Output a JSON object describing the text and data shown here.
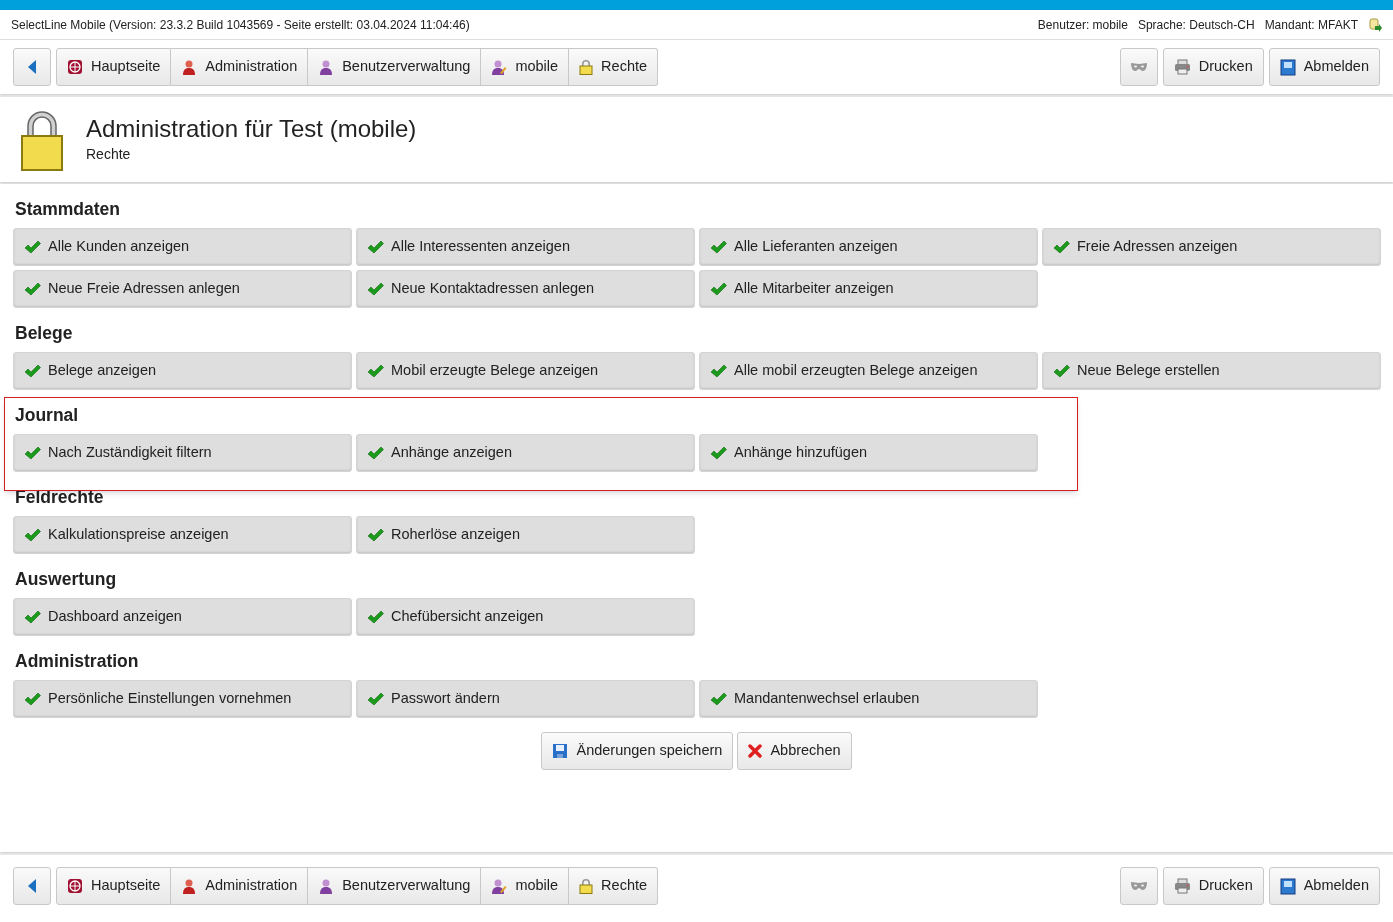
{
  "info_bar": {
    "version": "SelectLine Mobile (Version: 23.3.2 Build 1043569 - Seite erstellt: 03.04.2024 11:04:46)",
    "user": "Benutzer: mobile",
    "language": "Sprache: Deutsch-CH",
    "client": "Mandant: MFAKT"
  },
  "top_nav": {
    "breadcrumbs": [
      {
        "kind": "home",
        "label": "Hauptseite"
      },
      {
        "kind": "admin",
        "label": "Administration"
      },
      {
        "kind": "users",
        "label": "Benutzerverwaltung"
      },
      {
        "kind": "user",
        "label": "mobile"
      },
      {
        "kind": "lock",
        "label": "Rechte"
      }
    ],
    "actions": [
      {
        "kind": "mask"
      },
      {
        "kind": "print",
        "label": "Drucken"
      },
      {
        "kind": "logout",
        "label": "Abmelden"
      }
    ]
  },
  "page_header": {
    "title": "Administration für Test (mobile)",
    "subtitle": "Rechte"
  },
  "sections": [
    {
      "title": "Stammdaten",
      "highlighted": false,
      "permissions": [
        {
          "label": "Alle Kunden anzeigen",
          "checked": true
        },
        {
          "label": "Alle Interessenten anzeigen",
          "checked": true
        },
        {
          "label": "Alle Lieferanten anzeigen",
          "checked": true
        },
        {
          "label": "Freie Adressen anzeigen",
          "checked": true
        },
        {
          "label": "Neue Freie Adressen anlegen",
          "checked": true
        },
        {
          "label": "Neue Kontaktadressen anlegen",
          "checked": true
        },
        {
          "label": "Alle Mitarbeiter anzeigen",
          "checked": true
        }
      ]
    },
    {
      "title": "Belege",
      "highlighted": false,
      "permissions": [
        {
          "label": "Belege anzeigen",
          "checked": true
        },
        {
          "label": "Mobil erzeugte Belege anzeigen",
          "checked": true
        },
        {
          "label": "Alle mobil erzeugten Belege anzeigen",
          "checked": true
        },
        {
          "label": "Neue Belege erstellen",
          "checked": true
        }
      ]
    },
    {
      "title": "Journal",
      "highlighted": true,
      "permissions": [
        {
          "label": "Nach Zuständigkeit filtern",
          "checked": true
        },
        {
          "label": "Anhänge anzeigen",
          "checked": true
        },
        {
          "label": "Anhänge hinzufügen",
          "checked": true
        }
      ]
    },
    {
      "title": "Feldrechte",
      "highlighted": false,
      "permissions": [
        {
          "label": "Kalkulationspreise anzeigen",
          "checked": true
        },
        {
          "label": "Roherlöse anzeigen",
          "checked": true
        }
      ]
    },
    {
      "title": "Auswertung",
      "highlighted": false,
      "permissions": [
        {
          "label": "Dashboard anzeigen",
          "checked": true
        },
        {
          "label": "Chefübersicht anzeigen",
          "checked": true
        }
      ]
    },
    {
      "title": "Administration",
      "highlighted": false,
      "permissions": [
        {
          "label": "Persönliche Einstellungen vornehmen",
          "checked": true
        },
        {
          "label": "Passwort ändern",
          "checked": true
        },
        {
          "label": "Mandantenwechsel erlauben",
          "checked": true
        }
      ]
    }
  ],
  "form_buttons": [
    {
      "kind": "save",
      "label": "Änderungen speichern"
    },
    {
      "kind": "cancel",
      "label": "Abbrechen"
    }
  ],
  "bottom_nav": {
    "breadcrumbs": [
      {
        "kind": "home",
        "label": "Hauptseite"
      },
      {
        "kind": "admin",
        "label": "Administration"
      },
      {
        "kind": "users",
        "label": "Benutzerverwaltung"
      },
      {
        "kind": "user",
        "label": "mobile"
      },
      {
        "kind": "lock",
        "label": "Rechte"
      }
    ],
    "actions": [
      {
        "kind": "mask"
      },
      {
        "kind": "print",
        "label": "Drucken"
      },
      {
        "kind": "logout",
        "label": "Abmelden"
      }
    ]
  }
}
